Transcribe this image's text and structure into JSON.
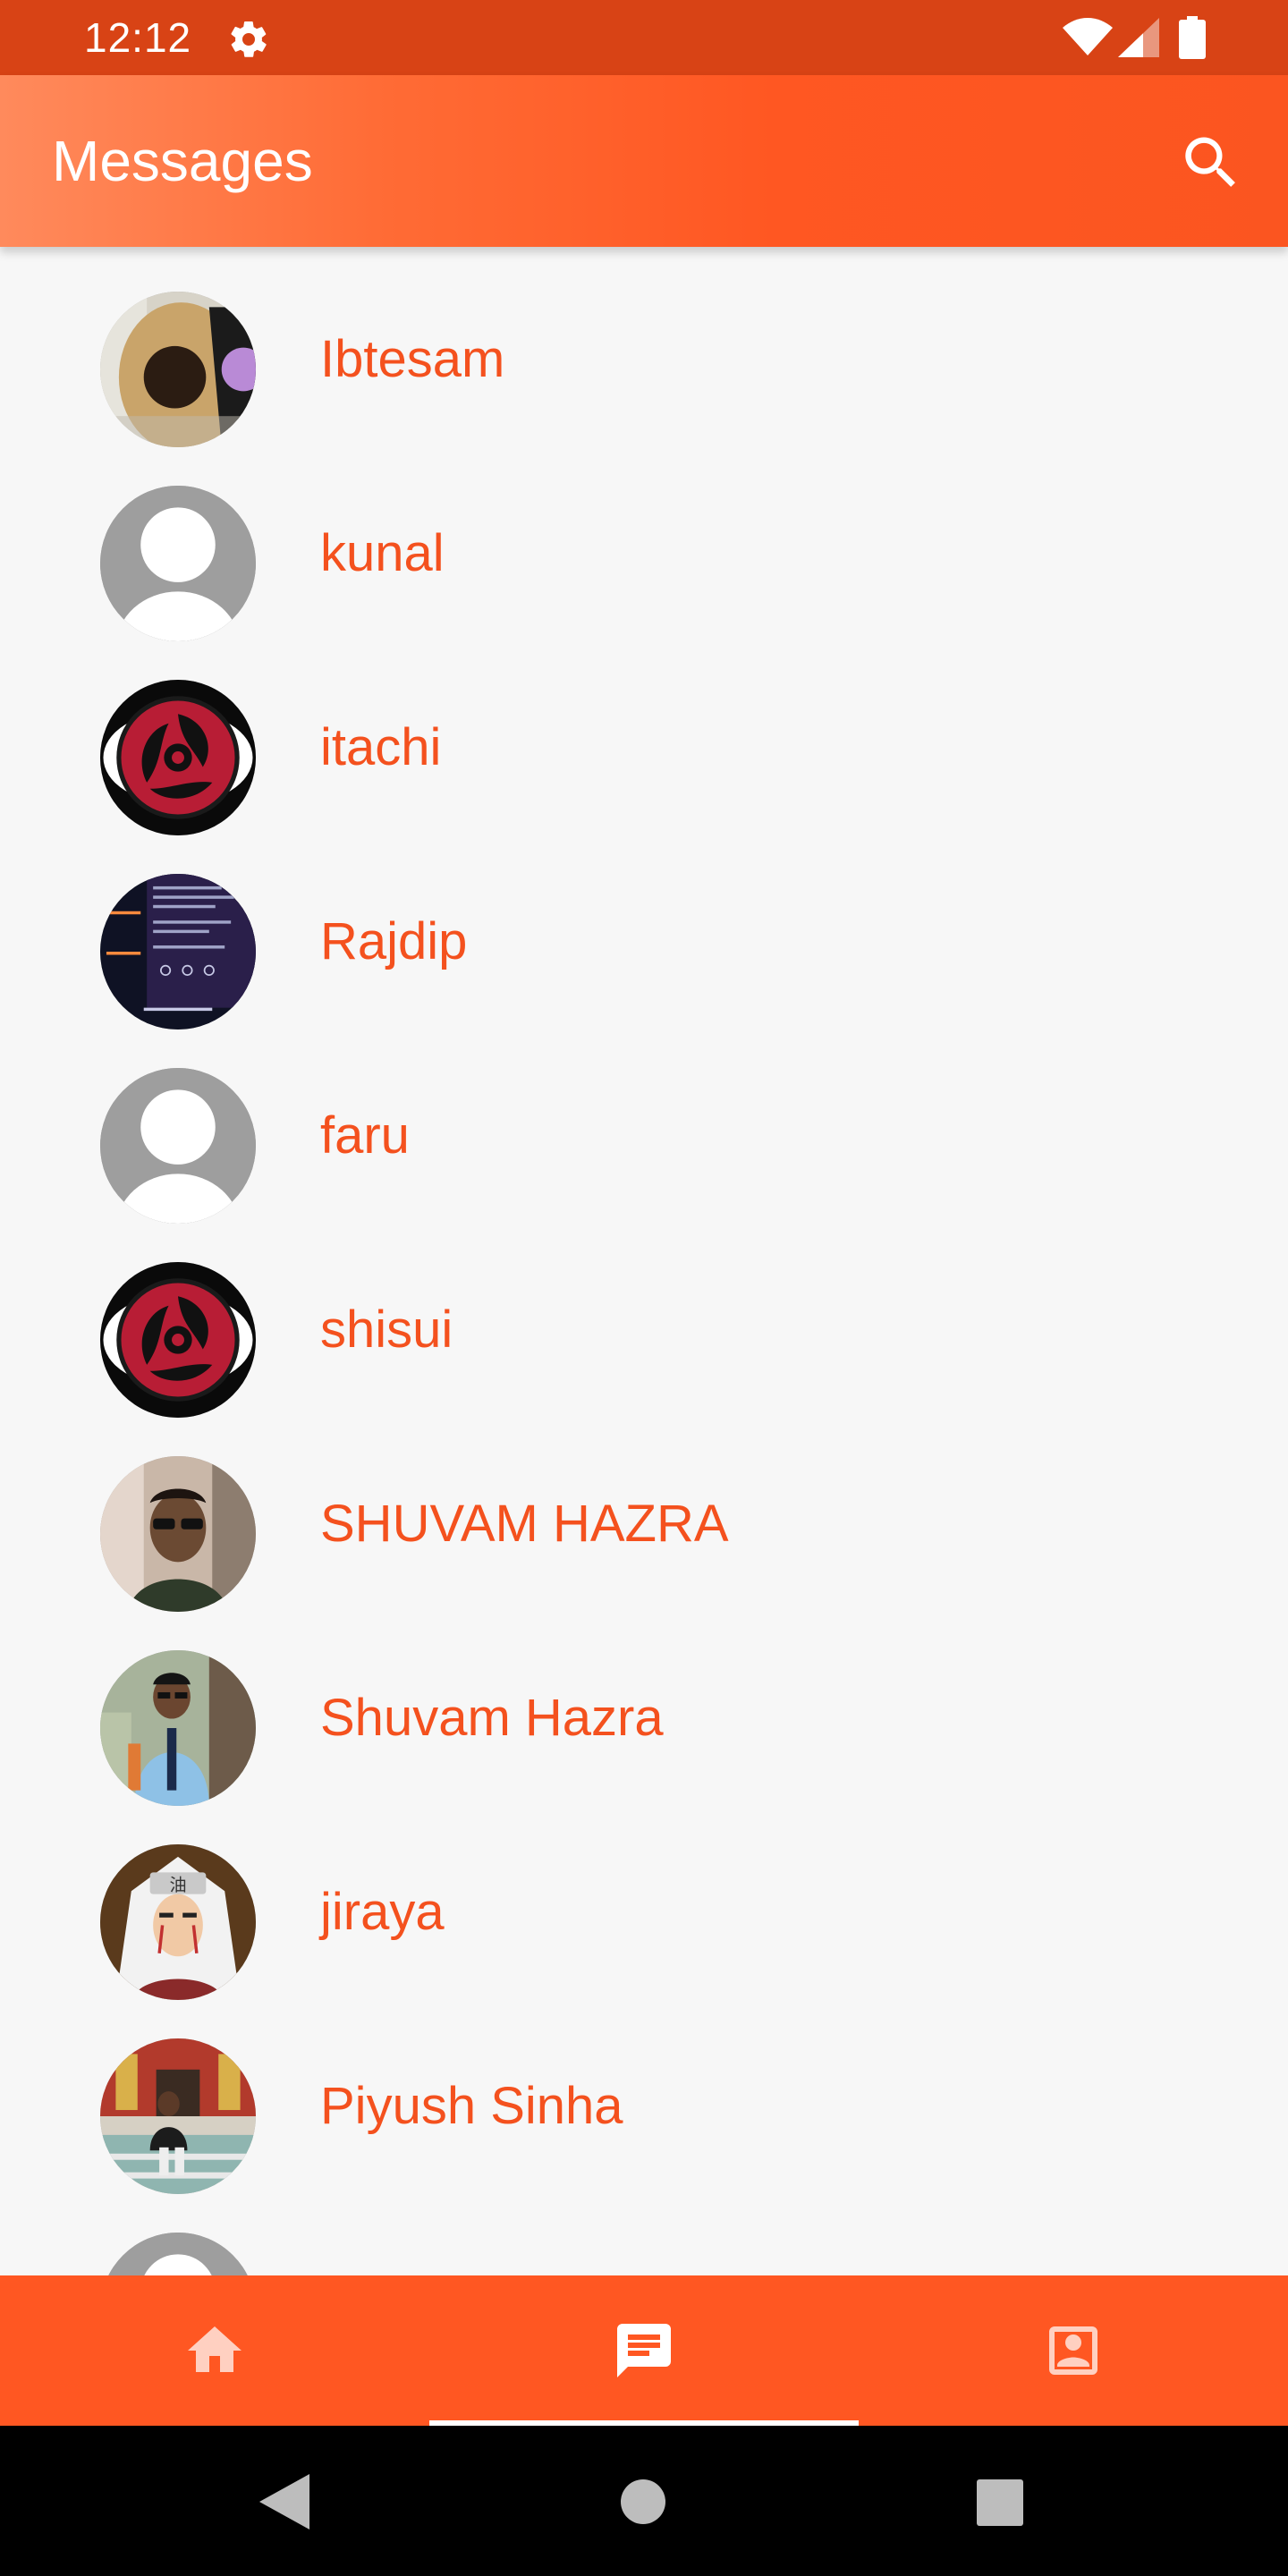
{
  "status_bar": {
    "time": "12:12",
    "icons": [
      "gear-icon",
      "wifi-icon",
      "signal-icon",
      "battery-icon"
    ]
  },
  "app_bar": {
    "title": "Messages",
    "search_icon": "search-icon",
    "gradient_colors": [
      "#ff8a5c",
      "#ff5722"
    ]
  },
  "colors": {
    "status_bar": "#d84315",
    "accent": "#ff5722",
    "name_text": "#f4511e",
    "list_background": "#f7f7f7"
  },
  "conversations": [
    {
      "name": "Ibtesam",
      "avatar": "guitar-photo"
    },
    {
      "name": "kunal",
      "avatar": "default-person"
    },
    {
      "name": "itachi",
      "avatar": "sharingan-eye"
    },
    {
      "name": "Rajdip",
      "avatar": "dark-screenshot"
    },
    {
      "name": "faru",
      "avatar": "default-person"
    },
    {
      "name": "shisui",
      "avatar": "sharingan-eye"
    },
    {
      "name": "SHUVAM HAZRA",
      "avatar": "selfie-photo"
    },
    {
      "name": "Shuvam Hazra",
      "avatar": "student-photo"
    },
    {
      "name": "jiraya",
      "avatar": "jiraiya-anime"
    },
    {
      "name": "Piyush Sinha",
      "avatar": "outdoor-photo"
    },
    {
      "name": "",
      "avatar": "default-person"
    }
  ],
  "bottom_nav": {
    "tabs": [
      {
        "icon": "home-icon",
        "selected": false
      },
      {
        "icon": "message-icon",
        "selected": true
      },
      {
        "icon": "contact-icon",
        "selected": false
      }
    ]
  },
  "system_nav": {
    "buttons": [
      "back-icon",
      "home-circle-icon",
      "recents-icon"
    ]
  }
}
